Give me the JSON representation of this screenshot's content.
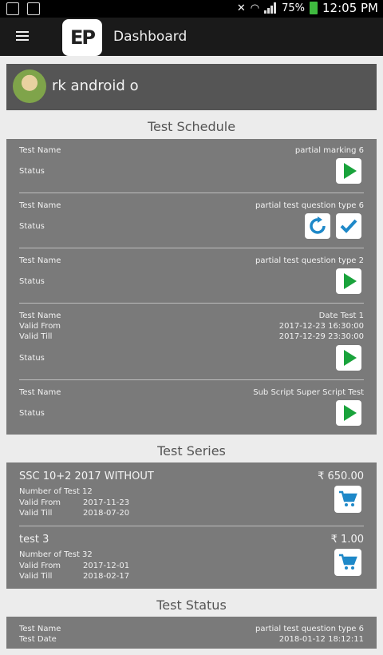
{
  "status_bar": {
    "battery": "75%",
    "time": "12:05 PM"
  },
  "app_bar": {
    "logo_text": "EP",
    "title": "Dashboard"
  },
  "profile": {
    "name": "rk android o"
  },
  "test_schedule": {
    "title": "Test Schedule",
    "labels": {
      "test_name": "Test Name",
      "status": "Status",
      "valid_from": "Valid From",
      "valid_till": "Valid Till"
    },
    "items": [
      {
        "name": "partial marking 6",
        "actions": [
          "play"
        ]
      },
      {
        "name": "partial test question type 6",
        "actions": [
          "refresh",
          "check"
        ]
      },
      {
        "name": "partial test question type 2",
        "actions": [
          "play"
        ]
      },
      {
        "name": "Date Test 1",
        "valid_from": "2017-12-23 16:30:00",
        "valid_till": "2017-12-29 23:30:00",
        "actions": [
          "play"
        ]
      },
      {
        "name": "Sub Script Super Script Test",
        "actions": [
          "play"
        ]
      }
    ]
  },
  "test_series": {
    "title": "Test Series",
    "labels": {
      "number_of_test": "Number of Test",
      "valid_from": "Valid From",
      "valid_till": "Valid Till"
    },
    "items": [
      {
        "name": "SSC 10+2 2017 WITHOUT",
        "price": "₹ 650.00",
        "number_of_test": "12",
        "number_of_test_text": "Number of Test 12",
        "valid_from": "2017-11-23",
        "valid_till": "2018-07-20"
      },
      {
        "name": "test 3",
        "price": "₹ 1.00",
        "number_of_test": "32",
        "number_of_test_text": "Number of Test 32",
        "valid_from": "2017-12-01",
        "valid_till": "2018-02-17"
      }
    ]
  },
  "test_status": {
    "title": "Test Status",
    "labels": {
      "test_name": "Test Name",
      "test_date": "Test Date"
    },
    "items": [
      {
        "name": "partial test question type 6",
        "date": "2018-01-12 18:12:11"
      }
    ]
  },
  "colors": {
    "panel": "#7a7a7a",
    "play": "#1aa33c",
    "action_blue": "#1e88c8",
    "appbar": "#1a1a1a"
  },
  "icons": {
    "play": "play-icon",
    "refresh": "refresh-icon",
    "check": "check-icon",
    "cart": "cart-icon",
    "menu": "menu-icon"
  }
}
